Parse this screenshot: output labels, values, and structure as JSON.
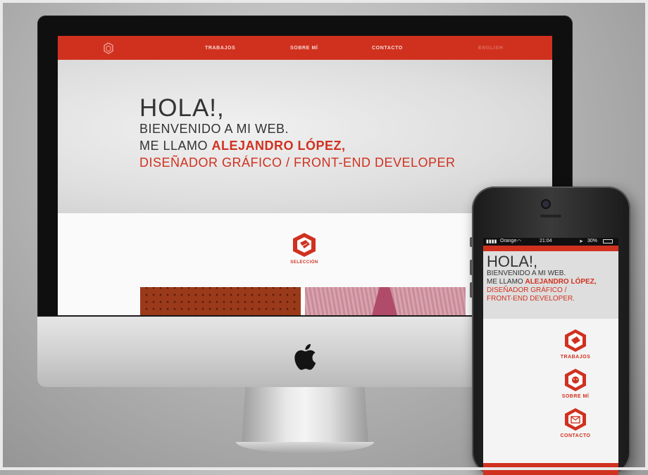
{
  "colors": {
    "accent": "#d0311f",
    "text": "#333333",
    "background": "#dedede"
  },
  "desktop_site": {
    "nav": {
      "logo_icon": "hexagon-logo-icon",
      "items": [
        "TRABAJOS",
        "SOBRE MÍ",
        "CONTACTO"
      ],
      "language": "ENGLISH"
    },
    "hero": {
      "line1": "HOLA!,",
      "line2": "BIENVENIDO A MI WEB.",
      "line3_prefix": "ME LLAMO ",
      "name": "ALEJANDRO LÓPEZ,",
      "line4": "DISEÑADOR GRÁFICO / FRONT-END DEVELOPER"
    },
    "selection": {
      "icon": "selection-hexagon-icon",
      "label": "SELECCIÓN"
    }
  },
  "mobile_site": {
    "status_bar": {
      "carrier": "Orange",
      "time": "21:04",
      "battery": "30%"
    },
    "hero": {
      "line1": "HOLA!,",
      "line2": "BIENVENIDO A MI WEB.",
      "line3_prefix": "ME LLAMO ",
      "name": "ALEJANDRO LÓPEZ,",
      "line4": "DISEÑADOR GRÁFICO /",
      "line5": "FRONT-END DEVELOPER."
    },
    "menu": [
      {
        "label": "TRABAJOS",
        "icon": "works-hexagon-icon"
      },
      {
        "label": "SOBRE MÍ",
        "icon": "about-hexagon-icon"
      },
      {
        "label": "CONTACTO",
        "icon": "contact-hexagon-icon"
      }
    ]
  },
  "device_icons": {
    "apple": "apple-logo-icon"
  }
}
